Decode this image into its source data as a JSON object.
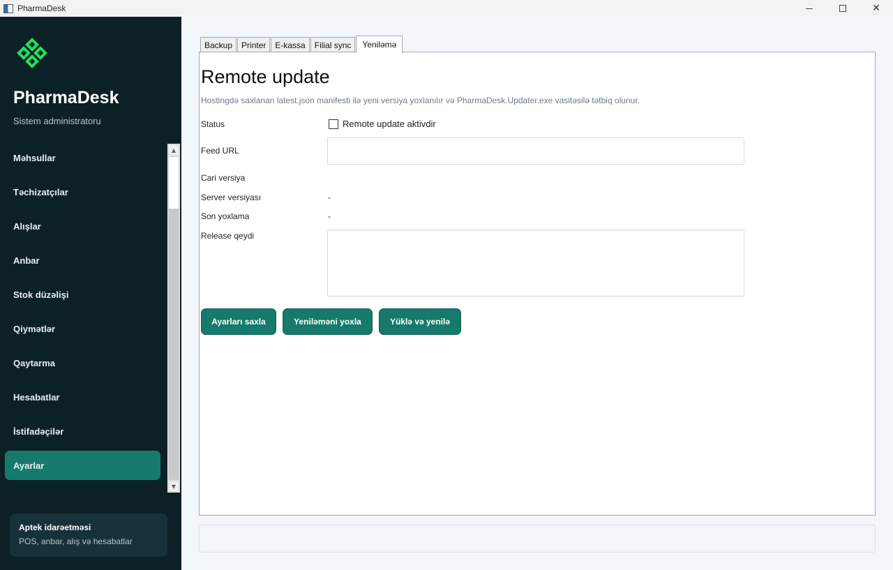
{
  "window": {
    "title": "PharmaDesk"
  },
  "sidebar": {
    "brand": "PharmaDesk",
    "role": "Sistem administratoru",
    "items": [
      {
        "label": "Məhsullar"
      },
      {
        "label": "Təchizatçılar"
      },
      {
        "label": "Alışlar"
      },
      {
        "label": "Anbar"
      },
      {
        "label": "Stok düzəlişi"
      },
      {
        "label": "Qiymətlər"
      },
      {
        "label": "Qaytarma"
      },
      {
        "label": "Hesabatlar"
      },
      {
        "label": "İstifadəçilər"
      },
      {
        "label": "Ayarlar",
        "active": true
      }
    ],
    "footer": {
      "title": "Aptek idarəetməsi",
      "subtitle": "POS, anbar, alış və hesabatlar"
    }
  },
  "tabs": [
    {
      "label": "Backup"
    },
    {
      "label": "Printer"
    },
    {
      "label": "E-kassa"
    },
    {
      "label": "Filial sync"
    },
    {
      "label": "Yeniləmə",
      "active": true
    }
  ],
  "update": {
    "title": "Remote update",
    "description": "Hostingdə saxlanan latest.json manifesti ilə yeni versiya yoxlanılır və PharmaDesk.Updater.exe vasitəsilə tətbiq olunur.",
    "status_label": "Status",
    "checkbox_label": "Remote update aktivdir",
    "checkbox_checked": false,
    "feed_url_label": "Feed URL",
    "feed_url_value": "",
    "current_version_label": "Cari versiya",
    "current_version_value": "",
    "server_version_label": "Server versiyası",
    "server_version_value": "-",
    "last_check_label": "Son yoxlama",
    "last_check_value": "-",
    "release_note_label": "Release qeydi",
    "release_note_value": ""
  },
  "buttons": {
    "save": "Ayarları saxla",
    "check": "Yeniləməni yoxla",
    "install": "Yüklə və yenilə"
  },
  "colors": {
    "sidebar_bg": "#0c2126",
    "accent": "#157a6c",
    "logo_green": "#22e05a"
  }
}
